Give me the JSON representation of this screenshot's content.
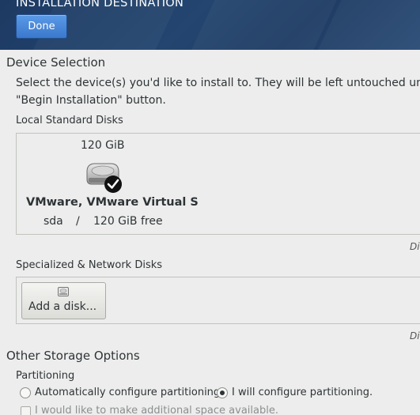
{
  "header": {
    "title": "INSTALLATION DESTINATION",
    "done_label": "Done"
  },
  "device_selection": {
    "title": "Device Selection",
    "intro_line1": "Select the device(s) you'd like to install to.  They will be left untouched un",
    "intro_line2": "\"Begin Installation\" button.",
    "local_disks_label": "Local Standard Disks",
    "disk": {
      "size": "120 GiB",
      "name": "VMware, VMware Virtual S",
      "device": "sda",
      "separator": "/",
      "free": "120 GiB free",
      "icon": "hard-drive-icon",
      "selected": true
    },
    "local_note": "Di",
    "specialized_label": "Specialized & Network Disks",
    "add_disk_label": "Add a disk...",
    "specialized_note": "Di"
  },
  "storage_options": {
    "title": "Other Storage Options",
    "partitioning_label": "Partitioning",
    "auto_label": "Automatically configure partitioning.",
    "manual_label": "I will configure partitioning.",
    "selected": "manual",
    "space_label": "I would like to make additional space available."
  },
  "colors": {
    "header_bg": "#23456f",
    "accent": "#3a78cc"
  }
}
